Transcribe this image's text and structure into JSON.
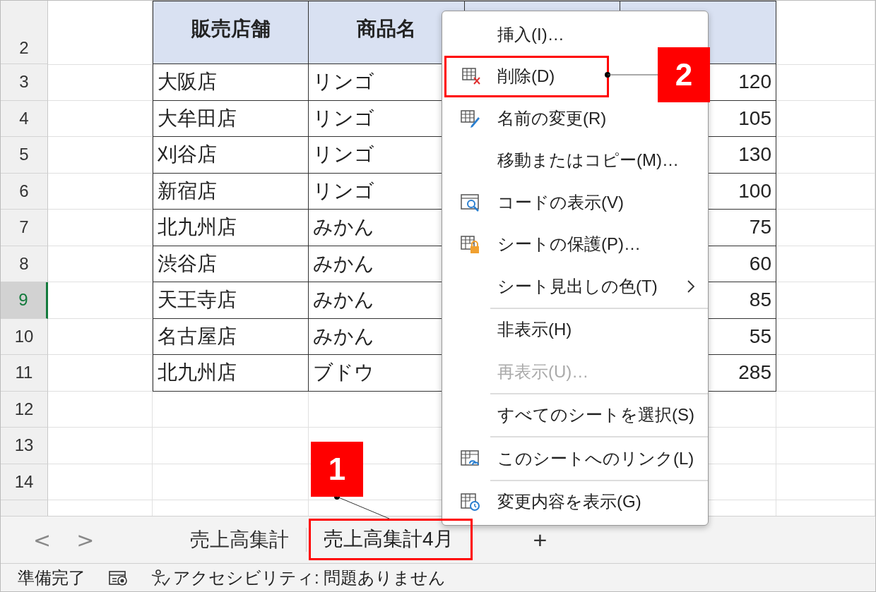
{
  "sheet": {
    "header_row": {
      "number": "2",
      "selected": false,
      "cells": [
        "販売店舗",
        "商品名"
      ]
    },
    "rows": [
      {
        "number": "3",
        "selected": false,
        "store": "大阪店",
        "product": "リンゴ",
        "price": "120"
      },
      {
        "number": "4",
        "selected": false,
        "store": "大牟田店",
        "product": "リンゴ",
        "price": "105"
      },
      {
        "number": "5",
        "selected": false,
        "store": "刈谷店",
        "product": "リンゴ",
        "price": "130"
      },
      {
        "number": "6",
        "selected": false,
        "store": "新宿店",
        "product": "リンゴ",
        "price": "100"
      },
      {
        "number": "7",
        "selected": false,
        "store": "北九州店",
        "product": "みかん",
        "price": "75"
      },
      {
        "number": "8",
        "selected": false,
        "store": "渋谷店",
        "product": "みかん",
        "price": "60"
      },
      {
        "number": "9",
        "selected": true,
        "store": "天王寺店",
        "product": "みかん",
        "price": "85"
      },
      {
        "number": "10",
        "selected": false,
        "store": "名古屋店",
        "product": "みかん",
        "price": "55"
      },
      {
        "number": "11",
        "selected": false,
        "store": "北九州店",
        "product": "ブドウ",
        "price": "285"
      },
      {
        "number": "12",
        "selected": false
      },
      {
        "number": "13",
        "selected": false
      },
      {
        "number": "14",
        "selected": false
      }
    ]
  },
  "context_menu": {
    "items": [
      {
        "label": "挿入(I)…",
        "kind": "plain",
        "disabled": false,
        "submenu": false,
        "separator_before": false
      },
      {
        "label": "削除(D)",
        "kind": "delete",
        "disabled": false,
        "submenu": false,
        "separator_before": false
      },
      {
        "label": "名前の変更(R)",
        "kind": "rename",
        "disabled": false,
        "submenu": false,
        "separator_before": false
      },
      {
        "label": "移動またはコピー(M)…",
        "kind": "plain",
        "disabled": false,
        "submenu": false,
        "separator_before": false
      },
      {
        "label": "コードの表示(V)",
        "kind": "code",
        "disabled": false,
        "submenu": false,
        "separator_before": false
      },
      {
        "label": "シートの保護(P)…",
        "kind": "protect",
        "disabled": false,
        "submenu": false,
        "separator_before": false
      },
      {
        "label": "シート見出しの色(T)",
        "kind": "plain",
        "disabled": false,
        "submenu": true,
        "separator_before": false
      },
      {
        "label": "非表示(H)",
        "kind": "plain",
        "disabled": false,
        "submenu": false,
        "separator_before": true
      },
      {
        "label": "再表示(U)…",
        "kind": "plain",
        "disabled": true,
        "submenu": false,
        "separator_before": false
      },
      {
        "label": "すべてのシートを選択(S)",
        "kind": "plain",
        "disabled": false,
        "submenu": false,
        "separator_before": true
      },
      {
        "label": "このシートへのリンク(L)",
        "kind": "link",
        "disabled": false,
        "submenu": false,
        "separator_before": true
      },
      {
        "label": "変更内容を表示(G)",
        "kind": "changes",
        "disabled": false,
        "submenu": false,
        "separator_before": true
      }
    ]
  },
  "sheet_tabs": {
    "nav": [
      "<",
      ">"
    ],
    "tabs": [
      {
        "label": "売上高集計",
        "selected": false
      },
      {
        "label": "売上高集計4月",
        "selected": true
      }
    ],
    "add": "+"
  },
  "status_bar": {
    "mode": "準備完了",
    "accessibility": "アクセシビリティ: 問題ありません"
  },
  "callouts": [
    {
      "number": "1"
    },
    {
      "number": "2"
    }
  ]
}
